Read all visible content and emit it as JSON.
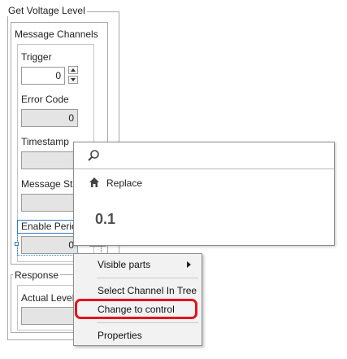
{
  "window": {
    "title": "Get Voltage Level"
  },
  "message_channels": {
    "title": "Message Channels",
    "trigger": {
      "label": "Trigger",
      "value": "0"
    },
    "error_code": {
      "label": "Error Code",
      "value": "0"
    },
    "timestamp": {
      "label": "Timestamp"
    },
    "message_status": {
      "label": "Message Sta"
    },
    "enable_periodic": {
      "label": "Enable Perio",
      "value": "0"
    }
  },
  "response": {
    "title": "Response",
    "actual_level": {
      "label": "Actual Level"
    }
  },
  "quick_drop": {
    "search_icon": "search-icon",
    "replace_icon": "home-icon",
    "replace_label": "Replace",
    "value": "0.1"
  },
  "context_menu": {
    "items": [
      {
        "label": "Visible parts",
        "has_submenu": true
      },
      {
        "label": "Select Channel In Tree"
      },
      {
        "label": "Change to control"
      },
      {
        "label": "Properties"
      }
    ],
    "submenu_arrow": "▶",
    "highlight_color": "#e0141e"
  }
}
